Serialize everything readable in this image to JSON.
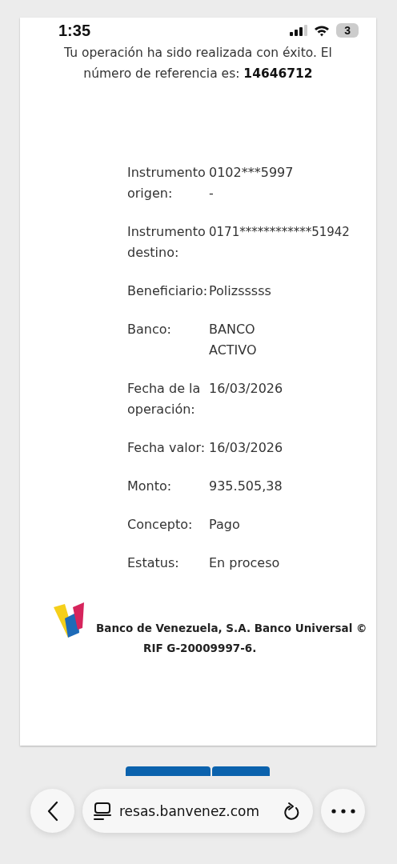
{
  "status_bar": {
    "time": "1:35",
    "battery": "3"
  },
  "message": {
    "text": "Tu operación ha sido realizada con éxito. El número de referencia es: ",
    "reference": "14646712"
  },
  "details": [
    {
      "label": "Instrumento origen:",
      "value": "0102***5997\n-"
    },
    {
      "label": "Instrumento destino:",
      "value": "0171************51942"
    },
    {
      "label": "Beneficiario:",
      "value": "Polizsssss"
    },
    {
      "label": "Banco:",
      "value": "BANCO ACTIVO"
    },
    {
      "label": "Fecha de la operación:",
      "value": "16/03/2026"
    },
    {
      "label": "Fecha valor:",
      "value": "16/03/2026"
    },
    {
      "label": "Monto:",
      "value": "935.505,38"
    },
    {
      "label": "Concepto:",
      "value": "Pago"
    },
    {
      "label": "Estatus:",
      "value": "En proceso"
    }
  ],
  "footer": {
    "line_1": "Banco de Venezuela, S.A. Banco Universal ©",
    "line_2": "RIF G-20009997-6."
  },
  "browser": {
    "url": "resas.banvenez.com"
  }
}
